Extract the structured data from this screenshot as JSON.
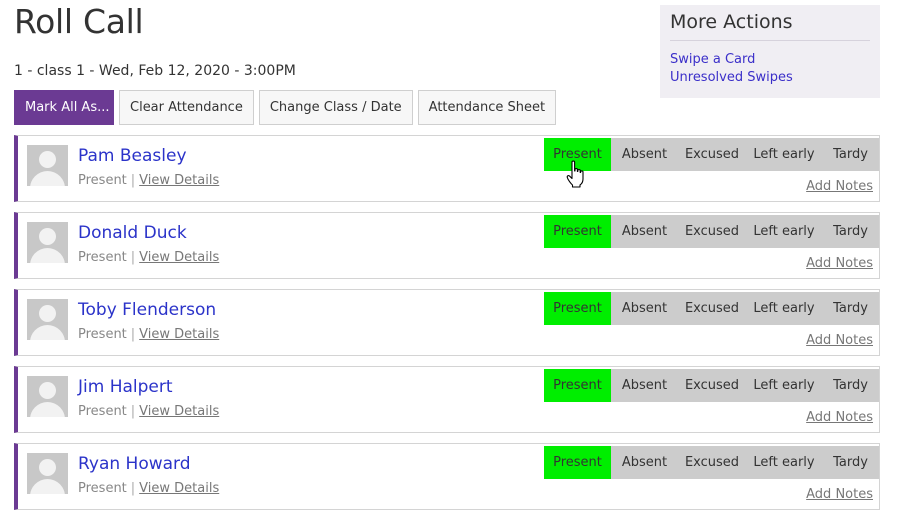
{
  "header": {
    "title": "Roll Call",
    "subtitle": "1 - class 1 - Wed, Feb 12, 2020 - 3:00PM"
  },
  "toolbar": {
    "mark_all_label": "Mark All As...",
    "clear_label": "Clear Attendance",
    "change_label": "Change Class / Date",
    "sheet_label": "Attendance Sheet"
  },
  "more_actions": {
    "title": "More Actions",
    "links": [
      "Swipe a Card",
      "Unresolved Swipes"
    ]
  },
  "attendance_options": [
    "Present",
    "Absent",
    "Excused",
    "Left early",
    "Tardy"
  ],
  "status_labels": {
    "view_details": "View Details",
    "add_notes": "Add Notes",
    "separator": "|"
  },
  "students": [
    {
      "name": "Pam Beasley",
      "status": "Present"
    },
    {
      "name": "Donald Duck",
      "status": "Present"
    },
    {
      "name": "Toby Flenderson",
      "status": "Present"
    },
    {
      "name": "Jim Halpert",
      "status": "Present"
    },
    {
      "name": "Ryan Howard",
      "status": "Present"
    }
  ],
  "colors": {
    "accent": "#6b3a93",
    "present_active": "#00ee00",
    "option_bg": "#cccccc",
    "link": "#2b33c9"
  },
  "icons": {
    "avatar": "user-avatar-icon",
    "cursor": "hand-pointer-icon"
  }
}
